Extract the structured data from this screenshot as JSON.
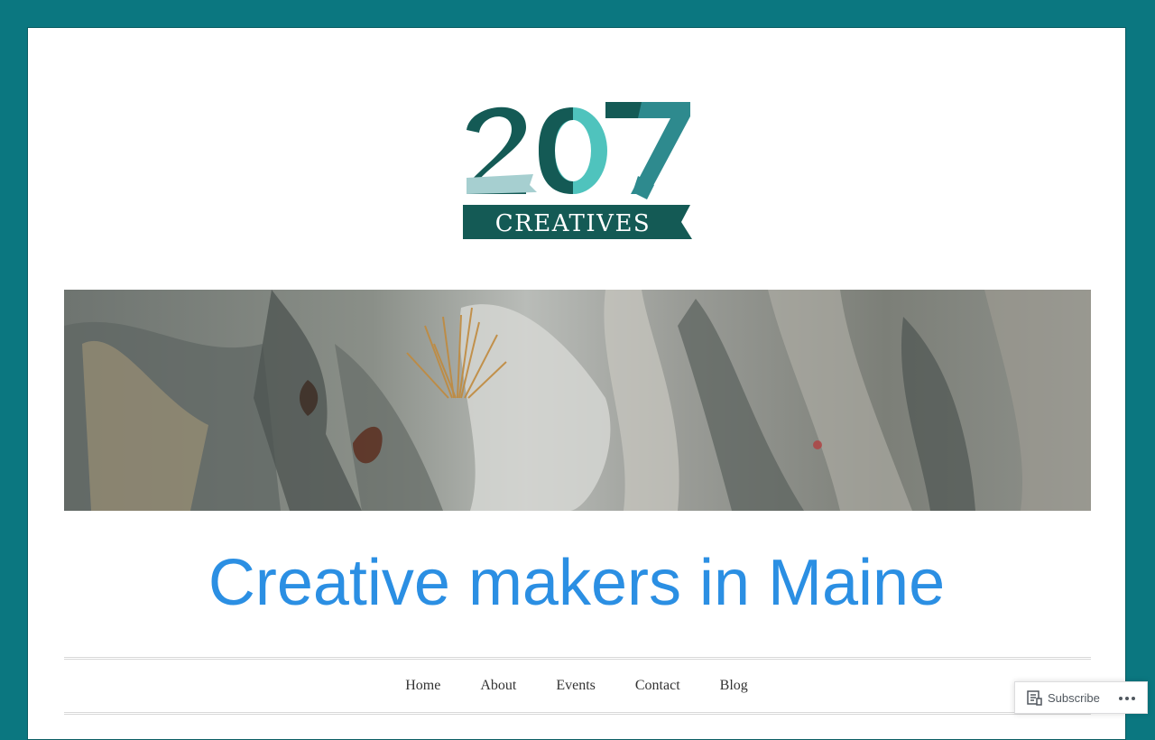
{
  "site": {
    "logo": {
      "number": "207",
      "banner_text": "CREATIVES"
    },
    "hero_image": "rocky-coast-photo",
    "tagline": "Creative makers in Maine"
  },
  "nav": {
    "items": [
      {
        "label": "Home"
      },
      {
        "label": "About"
      },
      {
        "label": "Events"
      },
      {
        "label": "Contact"
      },
      {
        "label": "Blog"
      }
    ]
  },
  "subscribe_bar": {
    "subscribe_label": "Subscribe",
    "subscribe_icon": "reader-icon",
    "more_icon": "ellipsis-icon"
  },
  "colors": {
    "background": "#0b7780",
    "tagline": "#2b8fe3",
    "logo_dark": "#145a55",
    "logo_teal": "#4fc3bd",
    "logo_mid": "#2e8a8e",
    "logo_light": "#a6cfd0"
  }
}
